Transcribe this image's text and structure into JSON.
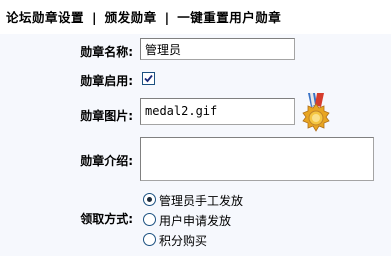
{
  "nav": {
    "items": [
      "论坛勋章设置",
      "颁发勋章",
      "一键重置用户勋章"
    ],
    "separator": "|"
  },
  "form": {
    "name_label": "勋章名称:",
    "name_value": "管理员",
    "enabled_label": "勋章启用:",
    "enabled_checked": true,
    "image_label": "勋章图片:",
    "image_value": "medal2.gif",
    "description_label": "勋章介绍:",
    "description_value": "",
    "method_label": "领取方式:",
    "method_options": [
      {
        "label": "管理员手工发放",
        "checked": true
      },
      {
        "label": "用户申请发放",
        "checked": false
      },
      {
        "label": "积分购买",
        "checked": false
      }
    ]
  },
  "colors": {
    "form_background": "#f6f8fd",
    "control_border": "#1c5180"
  },
  "icons": {
    "medal": "medal-icon",
    "checkbox": "checkmark-icon"
  }
}
